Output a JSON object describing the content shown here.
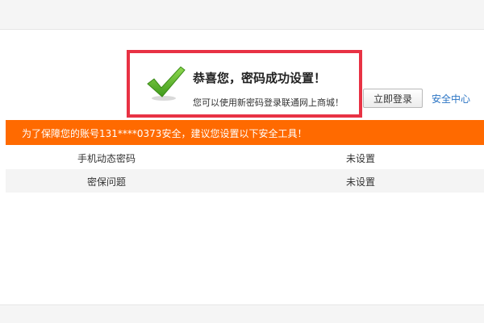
{
  "success": {
    "title": "恭喜您，密码成功设置！",
    "subtitle": "您可以使用新密码登录联通网上商城！",
    "icon": "checkmark-icon",
    "border_color": "#e83244",
    "icon_color": "#5cb82c"
  },
  "actions": {
    "login_label": "立即登录",
    "security_center_label": "安全中心",
    "link_color": "#2a74c4"
  },
  "notice": {
    "text": "为了保障您的账号131****0373安全，建议您设置以下安全工具！",
    "color": "#ff6a00"
  },
  "security_tools": [
    {
      "name": "手机动态密码",
      "status": "未设置"
    },
    {
      "name": "密保问题",
      "status": "未设置"
    }
  ]
}
